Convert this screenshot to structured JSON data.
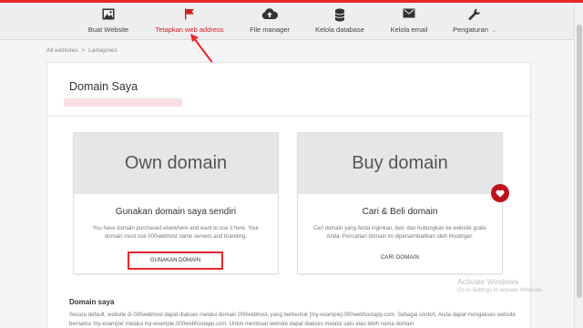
{
  "nav": {
    "items": [
      {
        "label": "Buat Website",
        "icon": "image-icon"
      },
      {
        "label": "Tetapkan web address",
        "icon": "flag-icon"
      },
      {
        "label": "File manager",
        "icon": "cloud-upload-icon"
      },
      {
        "label": "Kelola database",
        "icon": "database-icon"
      },
      {
        "label": "Kelola email",
        "icon": "envelope-icon"
      },
      {
        "label": "Pengaturan",
        "icon": "wrench-icon"
      }
    ],
    "active_color": "#d0202a"
  },
  "breadcrumb": {
    "root": "All websites",
    "separator": ">",
    "current": "Lamajones"
  },
  "page": {
    "title": "Domain Saya"
  },
  "options": {
    "own": {
      "hero": "Own domain",
      "subtitle": "Gunakan domain saya sendiri",
      "description": "You have domain purchased elsewhere and want to use it here. Your domain must use 000webhost name servers and branding.",
      "action": "GUNAKAN DOMAIN"
    },
    "buy": {
      "hero": "Buy domain",
      "subtitle": "Cari & Beli domain",
      "description": "Cari domain yang Anda inginkan, beli, dan hubungkan ke website gratis Anda. Pencarian domain ini dipersembahkan oleh Hostinger.",
      "action": "CARI DOMAIN",
      "badge_icon": "heart-icon"
    }
  },
  "section": {
    "title": "Domain saya",
    "text": "Secara default, website di 000webhost dapat diakses melalui domain 000webhost, yang berbentuk [my-example].000webhostapp.com. Sebagai contoh, Anda dapat mengakses website bernama 'my-example' melalui my-example.000webhostapp.com. Untuk membuat website dapat diakses melalui satu atau lebih nama domain"
  },
  "watermark": {
    "line1": "Activate Windows",
    "line2": "Go to Settings to activate Windows."
  },
  "colors": {
    "accent": "#e8262b",
    "badge": "#c0101d",
    "hero_bg": "#e6e6e6"
  }
}
